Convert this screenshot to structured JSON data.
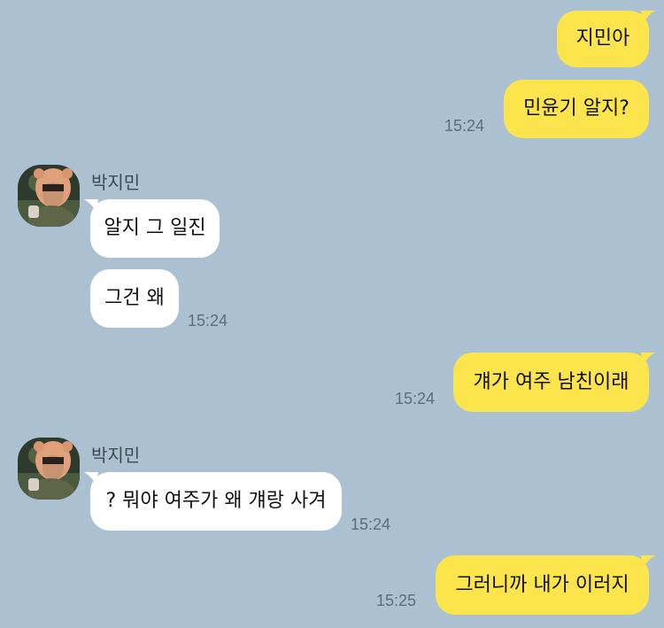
{
  "messages": [
    {
      "id": "m1",
      "sender": "me",
      "text": "지민아"
    },
    {
      "id": "m2",
      "sender": "me",
      "text": "민윤기 알지?",
      "time": "15:24"
    },
    {
      "id": "m3",
      "sender": "other",
      "name": "박지민",
      "text": "알지 그 일진"
    },
    {
      "id": "m4",
      "sender": "other",
      "text": "그건 왜",
      "time": "15:24"
    },
    {
      "id": "m5",
      "sender": "me",
      "text": "걔가 여주 남친이래",
      "time": "15:24"
    },
    {
      "id": "m6",
      "sender": "other",
      "name": "박지민",
      "text": "? 뭐야 여주가 왜 걔랑 사겨",
      "time": "15:24"
    },
    {
      "id": "m7",
      "sender": "me",
      "text": "그러니까 내가 이러지",
      "time": "15:25"
    }
  ],
  "colors": {
    "background": "#abc1d1",
    "my_bubble": "#fbe44c",
    "other_bubble": "#ffffff",
    "time_text": "#5d6d79"
  },
  "avatar": {
    "icon": "profile-photo-avatar"
  }
}
